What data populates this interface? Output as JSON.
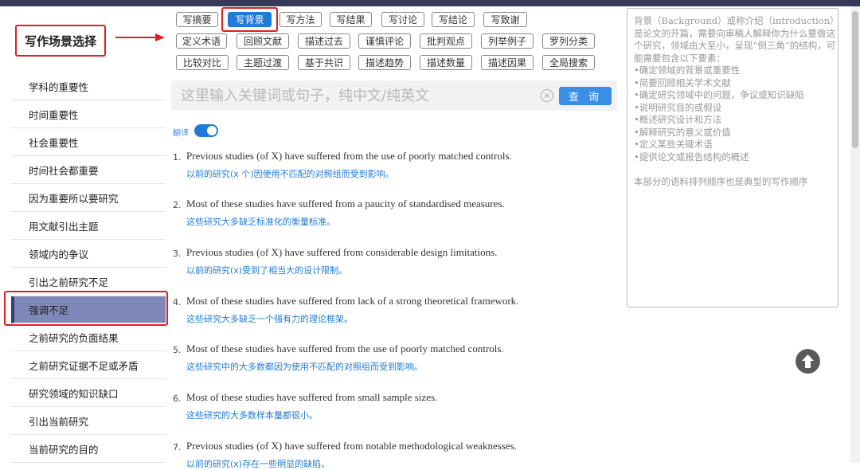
{
  "scene_label": "写作场景选择",
  "category_tabs": [
    {
      "label": "写摘要",
      "active": false
    },
    {
      "label": "写背景",
      "active": true
    },
    {
      "label": "写方法",
      "active": false
    },
    {
      "label": "写结果",
      "active": false
    },
    {
      "label": "写讨论",
      "active": false
    },
    {
      "label": "写结论",
      "active": false
    },
    {
      "label": "写致谢",
      "active": false
    }
  ],
  "function_tags_row1": [
    "定义术语",
    "回顾文献",
    "描述过去",
    "谨慎评论",
    "批判观点",
    "列举例子",
    "罗列分类"
  ],
  "function_tags_row2": [
    "比较对比",
    "主题过渡",
    "基于共识",
    "描述趋势",
    "描述数量",
    "描述因果",
    "全局搜索"
  ],
  "sidebar": {
    "items": [
      {
        "label": "学科的重要性",
        "active": false
      },
      {
        "label": "时间重要性",
        "active": false
      },
      {
        "label": "社会重要性",
        "active": false
      },
      {
        "label": "时间社会都重要",
        "active": false
      },
      {
        "label": "因为重要所以要研究",
        "active": false
      },
      {
        "label": "用文献引出主题",
        "active": false
      },
      {
        "label": "领域内的争议",
        "active": false
      },
      {
        "label": "引出之前研究不足",
        "active": false
      },
      {
        "label": "强调不足",
        "active": true
      },
      {
        "label": "之前研究的负面结果",
        "active": false
      },
      {
        "label": "之前研究证据不足或矛盾",
        "active": false
      },
      {
        "label": "研究领域的知识缺口",
        "active": false
      },
      {
        "label": "引出当前研究",
        "active": false
      },
      {
        "label": "当前研究的目的",
        "active": false
      }
    ]
  },
  "search": {
    "placeholder": "这里输入关键词或句子，纯中文/纯英文",
    "value": "",
    "button_label": "查 询",
    "clear_icon": "×"
  },
  "translate_toggle": {
    "label": "翻译",
    "on": true
  },
  "results": [
    {
      "num": "1.",
      "en": "Previous studies (of X) have suffered from the use of poorly matched controls.",
      "zh": "以前的研究(x 个)因使用不匹配的对照组而受到影响。"
    },
    {
      "num": "2.",
      "en": "Most of these studies have suffered from a paucity of standardised measures.",
      "zh": "这些研究大多缺乏标准化的衡量标准。"
    },
    {
      "num": "3.",
      "en": "Previous studies (of X) have suffered from considerable design limitations.",
      "zh": "以前的研究(x)受到了相当大的设计限制。"
    },
    {
      "num": "4.",
      "en": "Most of these studies have suffered from lack of a strong theoretical framework.",
      "zh": "这些研究大多缺乏一个强有力的理论框架。"
    },
    {
      "num": "5.",
      "en": "Most of these studies have suffered from the use of poorly matched controls.",
      "zh": "这些研究中的大多数都因为使用不匹配的对照组而受到影响。"
    },
    {
      "num": "6.",
      "en": "Most of these studies have suffered from small sample sizes.",
      "zh": "这些研究的大多数样本量都很小。"
    },
    {
      "num": "7.",
      "en": "Previous studies (of X) have suffered from notable methodological weaknesses.",
      "zh": "以前的研究(x)存在一些明显的缺陷。"
    }
  ],
  "info_panel": {
    "text": "背景（Background）或称介绍（introduction）是论文的开篇，需要向审稿人解释你为什么要做这个研究，领域由大至小，呈现“倒三角”的结构，可能需要包含以下要素：\n•确定领域的背景或重要性\n•简要回顾相关学术文献\n•确定研究领域中的问题，争议或知识缺陷\n•说明研究目的或假设\n•概述研究设计和方法\n•解释研究的意义或价值\n•定义某些关键术语\n•提供论文或报告结构的概述\n\n本部分的语料排列顺序也是典型的写作顺序"
  },
  "colors": {
    "accent": "#1f7ad8",
    "annotation": "#e02020",
    "sidebar_active": "#7f86b8",
    "topbar": "#363958"
  },
  "icons": {
    "arrow": "red-arrow-icon",
    "up": "arrow-up-circle-icon",
    "clear": "clear-circle-icon"
  }
}
